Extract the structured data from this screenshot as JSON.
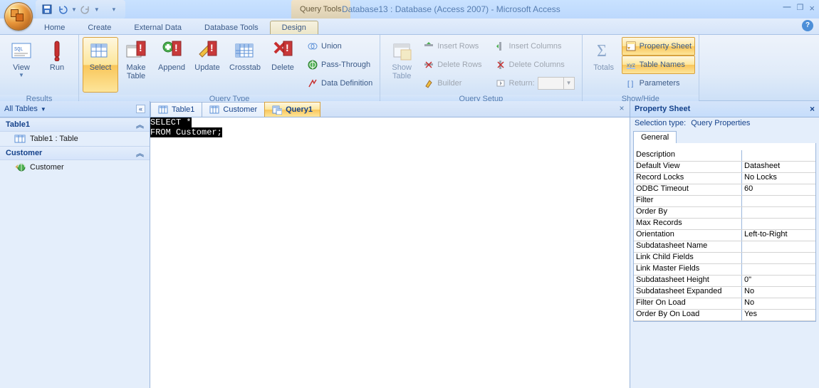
{
  "title": "Database13 : Database (Access 2007) - Microsoft Access",
  "context_tab": "Query Tools",
  "menu": [
    "Home",
    "Create",
    "External Data",
    "Database Tools",
    "Design"
  ],
  "active_menu": 4,
  "qat": [
    "save-icon",
    "undo-icon",
    "redo-icon",
    "customize-down-icon"
  ],
  "ribbon": {
    "results": {
      "label": "Results",
      "view": "View",
      "run": "Run"
    },
    "querytype": {
      "label": "Query Type",
      "select": "Select",
      "maketable": "Make\nTable",
      "append": "Append",
      "update": "Update",
      "crosstab": "Crosstab",
      "delete": "Delete",
      "union": "Union",
      "passthrough": "Pass-Through",
      "datadef": "Data Definition"
    },
    "querysetup": {
      "label": "Query Setup",
      "showtable": "Show\nTable",
      "insertrows": "Insert Rows",
      "deleterows": "Delete Rows",
      "builder": "Builder",
      "insertcols": "Insert Columns",
      "deletecols": "Delete Columns",
      "return": "Return:"
    },
    "showhide": {
      "label": "Show/Hide",
      "totals": "Totals",
      "propsheet": "Property Sheet",
      "tablenames": "Table Names",
      "parameters": "Parameters"
    }
  },
  "nav": {
    "header": "All Tables",
    "groups": [
      {
        "name": "Table1",
        "items": [
          {
            "icon": "table",
            "label": "Table1 : Table"
          }
        ]
      },
      {
        "name": "Customer",
        "items": [
          {
            "icon": "globe",
            "label": "Customer"
          }
        ]
      }
    ]
  },
  "doctabs": [
    {
      "icon": "table",
      "label": "Table1",
      "active": false
    },
    {
      "icon": "table",
      "label": "Customer",
      "active": false
    },
    {
      "icon": "query",
      "label": "Query1",
      "active": true
    }
  ],
  "sql": "SELECT *\nFROM Customer;",
  "prop": {
    "title": "Property Sheet",
    "seltype_label": "Selection type:",
    "seltype_value": "Query Properties",
    "tab": "General",
    "rows": [
      {
        "n": "Description",
        "v": ""
      },
      {
        "n": "Default View",
        "v": "Datasheet"
      },
      {
        "n": "Record Locks",
        "v": "No Locks"
      },
      {
        "n": "ODBC Timeout",
        "v": "60"
      },
      {
        "n": "Filter",
        "v": ""
      },
      {
        "n": "Order By",
        "v": ""
      },
      {
        "n": "Max Records",
        "v": ""
      },
      {
        "n": "Orientation",
        "v": "Left-to-Right"
      },
      {
        "n": "Subdatasheet Name",
        "v": ""
      },
      {
        "n": "Link Child Fields",
        "v": ""
      },
      {
        "n": "Link Master Fields",
        "v": ""
      },
      {
        "n": "Subdatasheet Height",
        "v": "0\""
      },
      {
        "n": "Subdatasheet Expanded",
        "v": "No"
      },
      {
        "n": "Filter On Load",
        "v": "No"
      },
      {
        "n": "Order By On Load",
        "v": "Yes"
      }
    ]
  }
}
